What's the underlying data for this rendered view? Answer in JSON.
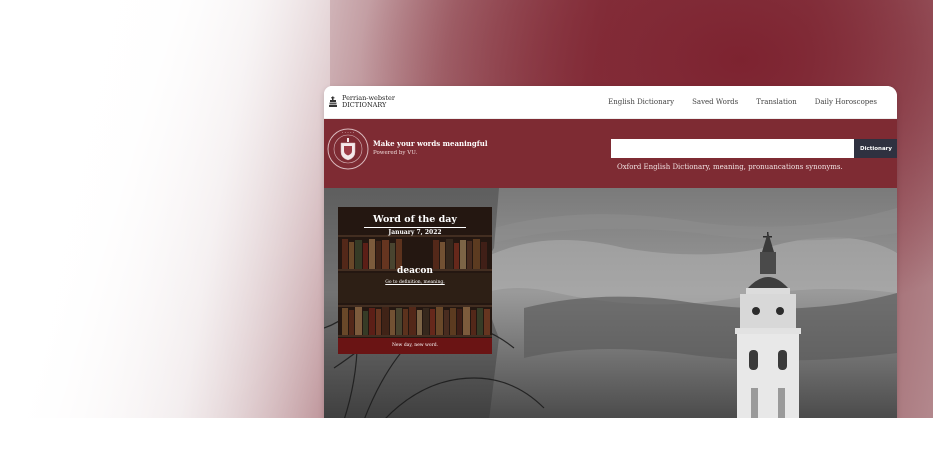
{
  "brand": {
    "line1": "Perrian-webster",
    "line2": "DICTIONARY"
  },
  "nav": {
    "items": [
      "English Dictionary",
      "Saved Words",
      "Translation",
      "Daily Horoscopes"
    ]
  },
  "hero": {
    "tagline": "Make your words meaningful",
    "powered_by": "Powered by VU.",
    "search_placeholder": "",
    "search_button": "Dictionary",
    "description": "Oxford English Dictionary, meaning, pronuancations synonyms."
  },
  "word_of_day": {
    "title": "Word of the day",
    "date": "January 7, 2022",
    "word": "deacon",
    "link": "Go to definition, meaning.",
    "footer": "New day, new word."
  },
  "colors": {
    "brand_maroon": "#7e2b33",
    "button_dark": "#2f3140",
    "footer_red": "#6a1414"
  }
}
